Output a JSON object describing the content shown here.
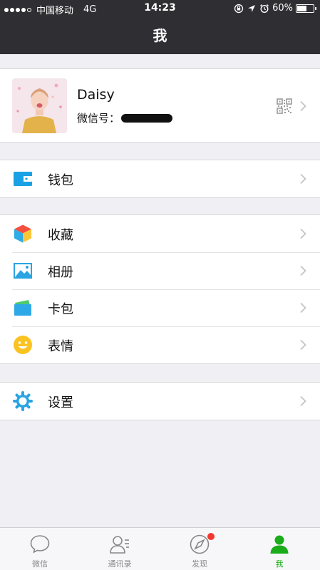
{
  "status_bar": {
    "carrier": "中国移动",
    "network": "4G",
    "time": "14:23",
    "battery_text": "60%",
    "battery_level": 0.6,
    "signal_bars_filled": 4,
    "icons": [
      "rotation-lock-icon",
      "location-arrow-icon",
      "alarm-icon"
    ]
  },
  "nav": {
    "title": "我"
  },
  "profile": {
    "name": "Daisy",
    "wechat_id_label": "微信号：",
    "qr_icon": "qr-code-icon"
  },
  "menu": {
    "wallet": {
      "label": "钱包",
      "icon": "wallet-icon",
      "color": "#1aa1e5"
    },
    "favorites": {
      "label": "收藏",
      "icon": "cube-icon",
      "colors": [
        "#f44f3f",
        "#2dace5",
        "#fbc638"
      ]
    },
    "album": {
      "label": "相册",
      "icon": "photo-icon",
      "color": "#2aa4e3"
    },
    "cards": {
      "label": "卡包",
      "icon": "card-icon",
      "colors": [
        "#2ea8e6",
        "#4fca6d"
      ]
    },
    "stickers": {
      "label": "表情",
      "icon": "emoji-icon",
      "color": "#fbc321"
    },
    "settings": {
      "label": "设置",
      "icon": "gear-icon",
      "color": "#2aa4e3"
    }
  },
  "tabbar": {
    "tabs": [
      {
        "label": "微信",
        "icon": "chat-icon",
        "active": false
      },
      {
        "label": "通讯录",
        "icon": "contacts-icon",
        "active": false
      },
      {
        "label": "发现",
        "icon": "compass-icon",
        "active": false,
        "badge": true
      },
      {
        "label": "我",
        "icon": "person-icon",
        "active": true
      }
    ],
    "active_color": "#1aad19",
    "inactive_color": "#888888",
    "badge_color": "#f43530"
  }
}
